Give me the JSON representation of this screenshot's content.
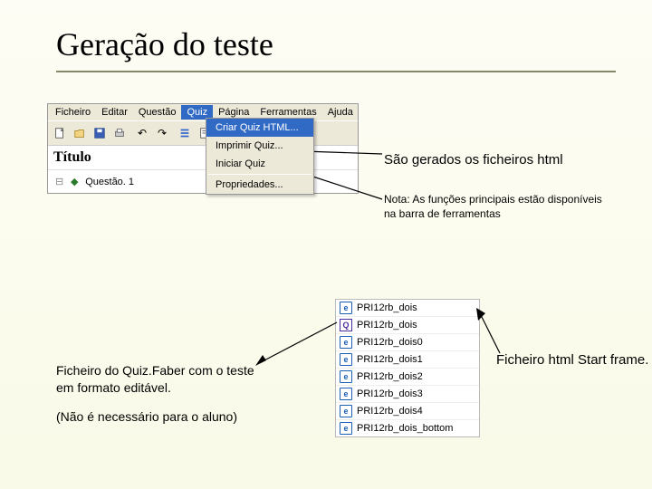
{
  "title": "Geração do teste",
  "menubar": [
    "Ficheiro",
    "Editar",
    "Questão",
    "Quiz",
    "Página",
    "Ferramentas",
    "Ajuda"
  ],
  "menubar_active_index": 3,
  "dropdown": {
    "items": [
      "Criar Quiz HTML...",
      "Imprimir Quiz...",
      "Iniciar Quiz",
      "Propriedades..."
    ],
    "selected_index": 0
  },
  "titulo_label": "Título",
  "tree_item": "Questão. 1",
  "annot": {
    "generated": "São gerados os ficheiros html",
    "note": "Nota: As funções principais estão disponíveis na barra de ferramentas",
    "quizfaber": "Ficheiro do Quiz.Faber com o teste em formato editável.",
    "quizfaber2": "(Não é necessário para o aluno)",
    "startframe": "Ficheiro html Start frame."
  },
  "files": [
    {
      "icon": "ie",
      "name": "PRI12rb_dois"
    },
    {
      "icon": "q",
      "name": "PRI12rb_dois"
    },
    {
      "icon": "ie",
      "name": "PRI12rb_dois0"
    },
    {
      "icon": "ie",
      "name": "PRI12rb_dois1"
    },
    {
      "icon": "ie",
      "name": "PRI12rb_dois2"
    },
    {
      "icon": "ie",
      "name": "PRI12rb_dois3"
    },
    {
      "icon": "ie",
      "name": "PRI12rb_dois4"
    },
    {
      "icon": "ie",
      "name": "PRI12rb_dois_bottom"
    }
  ]
}
